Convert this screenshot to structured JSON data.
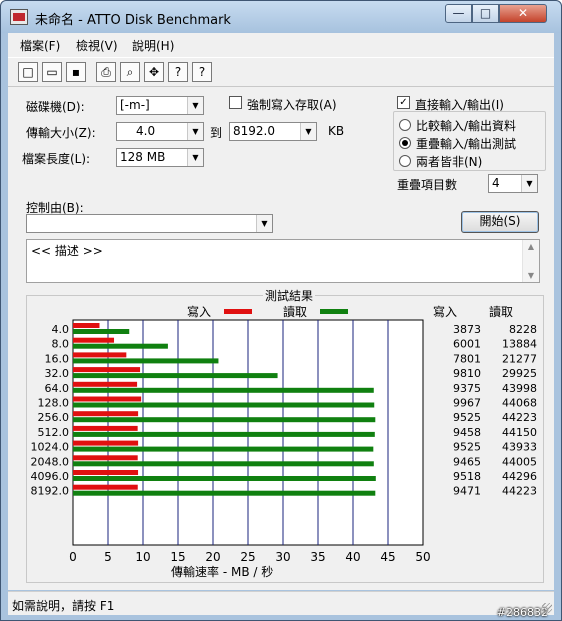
{
  "window": {
    "title": "未命名 - ATTO Disk Benchmark",
    "buttons": {
      "minimize": "—",
      "maximize": "□",
      "close": "✕"
    }
  },
  "menu": [
    {
      "label": "檔案(F)"
    },
    {
      "label": "檢視(V)"
    },
    {
      "label": "說明(H)"
    }
  ],
  "toolbar": {
    "icons": [
      "new-document-icon",
      "open-folder-icon",
      "save-icon",
      "print-icon",
      "print-preview-icon",
      "move-icon",
      "help-icon",
      "context-help-icon"
    ],
    "glyphs": [
      "□",
      "▭",
      "▪",
      "⎙",
      "⌕",
      "✥",
      "?",
      "?"
    ]
  },
  "form": {
    "drive_label": "磁碟機(D):",
    "drive_value": "[-m-]",
    "transfer_label": "傳輸大小(Z):",
    "transfer_from": "4.0",
    "to_label": "到",
    "transfer_to": "8192.0",
    "unit_label": "KB",
    "length_label": "檔案長度(L):",
    "length_value": "128 MB",
    "force_write_label": "強制寫入存取(A)",
    "force_write_checked": false,
    "direct_io_label": "直接輸入/輸出(I)",
    "direct_io_checked": true,
    "radio_options": [
      {
        "label": "比較輸入/輸出資料",
        "selected": false
      },
      {
        "label": "重疊輸入/輸出測試",
        "selected": true
      },
      {
        "label": "兩者皆非(N)",
        "selected": false
      }
    ],
    "queue_label": "重疊項目數",
    "queue_value": "4",
    "controlled_by_label": "控制由(B):",
    "controlled_by_value": "",
    "start_button": "開始(S)",
    "description_text": "<<   描述   >>"
  },
  "results": {
    "title": "測試結果",
    "write_legend": "寫入",
    "read_legend": "讀取",
    "write_header": "寫入",
    "read_header": "讀取",
    "xaxis_label": "傳輸速率 - MB / 秒",
    "write_color": "#e01010",
    "read_color": "#108010"
  },
  "chart_data": {
    "type": "bar",
    "orientation": "horizontal",
    "title": "測試結果",
    "xlabel": "傳輸速率 - MB / 秒",
    "ylabel": "",
    "categories": [
      "4.0",
      "8.0",
      "16.0",
      "32.0",
      "64.0",
      "128.0",
      "256.0",
      "512.0",
      "1024.0",
      "2048.0",
      "4096.0",
      "8192.0"
    ],
    "series": [
      {
        "name": "寫入",
        "values": [
          3873,
          6001,
          7801,
          9810,
          9375,
          9967,
          9525,
          9458,
          9525,
          9465,
          9518,
          9471
        ]
      },
      {
        "name": "讀取",
        "values": [
          8228,
          13884,
          21277,
          29925,
          43998,
          44068,
          44223,
          44150,
          43933,
          44005,
          44296,
          44223
        ]
      }
    ],
    "xticks": [
      "0",
      "5",
      "10",
      "15",
      "20",
      "25",
      "30",
      "35",
      "40",
      "45",
      "50"
    ],
    "xlim": [
      0,
      50
    ],
    "grid": true,
    "legend": "top"
  },
  "status": {
    "text": "如需說明，請按 F1",
    "watermark": "#286832"
  }
}
